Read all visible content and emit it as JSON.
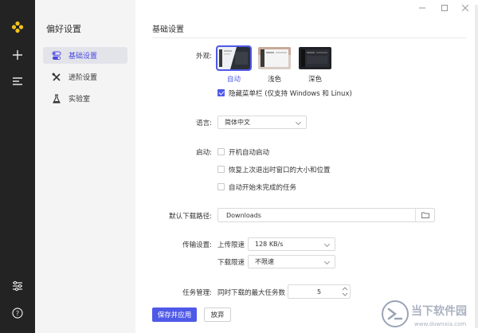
{
  "rail": {
    "icons": [
      "app-logo-icon",
      "add-icon",
      "menu-icon",
      "sliders-icon",
      "help-icon"
    ]
  },
  "sidebar": {
    "title": "偏好设置",
    "items": [
      {
        "label": "基础设置",
        "icon": "toggle-icon",
        "active": true
      },
      {
        "label": "进阶设置",
        "icon": "tools-icon",
        "active": false
      },
      {
        "label": "实验室",
        "icon": "flask-icon",
        "active": false
      }
    ]
  },
  "main": {
    "title": "基础设置",
    "appearance": {
      "label": "外观:",
      "themes": [
        {
          "label": "自动",
          "selected": true
        },
        {
          "label": "浅色",
          "selected": false
        },
        {
          "label": "深色",
          "selected": false
        }
      ],
      "hide_menubar": {
        "label": "隐藏菜单栏 (仅支持 Windows 和 Linux)",
        "checked": true
      }
    },
    "language": {
      "label": "语言:",
      "value": "简体中文"
    },
    "startup": {
      "label": "启动:",
      "options": [
        {
          "label": "开机自动启动",
          "checked": false
        },
        {
          "label": "恢复上次退出时窗口的大小和位置",
          "checked": false
        },
        {
          "label": "自动开始未完成的任务",
          "checked": false
        }
      ]
    },
    "download_path": {
      "label": "默认下载路径:",
      "value": "Downloads"
    },
    "transfer": {
      "label": "传输设置:",
      "upload_label": "上传限速",
      "upload_value": "128 KB/s",
      "download_label": "下载限速",
      "download_value": "不限速"
    },
    "tasks": {
      "label": "任务管理:",
      "max_label": "同时下载的最大任务数",
      "max_value": "5"
    },
    "buttons": {
      "save": "保存并应用",
      "discard": "放弃"
    }
  },
  "watermark": {
    "text": "当下软件园",
    "url": "www.downxia.com"
  },
  "colors": {
    "accent": "#4f59e8",
    "rail": "#232323",
    "sidebar": "#f4f4f5"
  }
}
